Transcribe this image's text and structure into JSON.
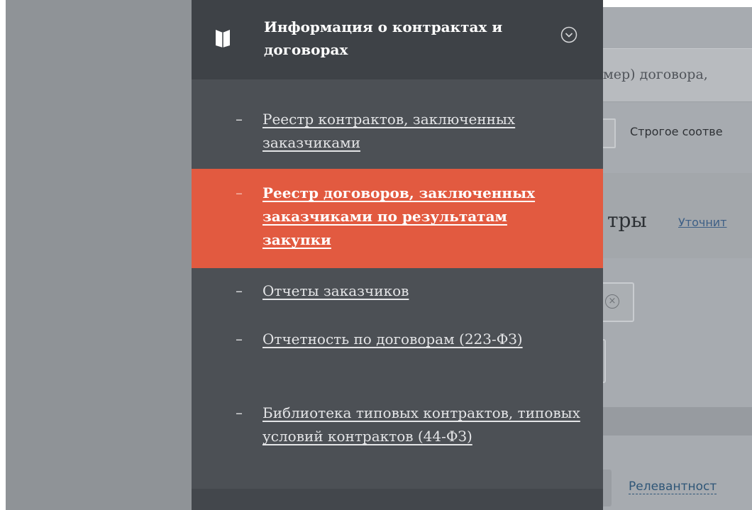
{
  "menu": {
    "title": "Информация о контрактах и договорах",
    "items": [
      {
        "label": "Реестр контрактов, заключенных заказчиками",
        "active": false
      },
      {
        "label": "Реестр договоров, заключенных заказчиками по результатам закупки",
        "active": true
      },
      {
        "label": "Отчеты заказчиков",
        "active": false
      },
      {
        "label": "Отчетность по договорам (223-ФЗ)",
        "active": false
      },
      {
        "label": "Библиотека типовых контрактов, типовых условий контрактов (44-ФЗ)",
        "active": false
      }
    ],
    "dash": "–"
  },
  "background": {
    "search_text": "мер) договора, ",
    "strict_match": "Строгое соотве",
    "filters_heading": "тры",
    "clarify_link": "Уточнит",
    "clear_glyph": "×",
    "sort_link": "Релевантност"
  },
  "colors": {
    "active_item": "#e25a40",
    "menu_bg": "#4c5055",
    "header_bg": "#3e4247"
  }
}
